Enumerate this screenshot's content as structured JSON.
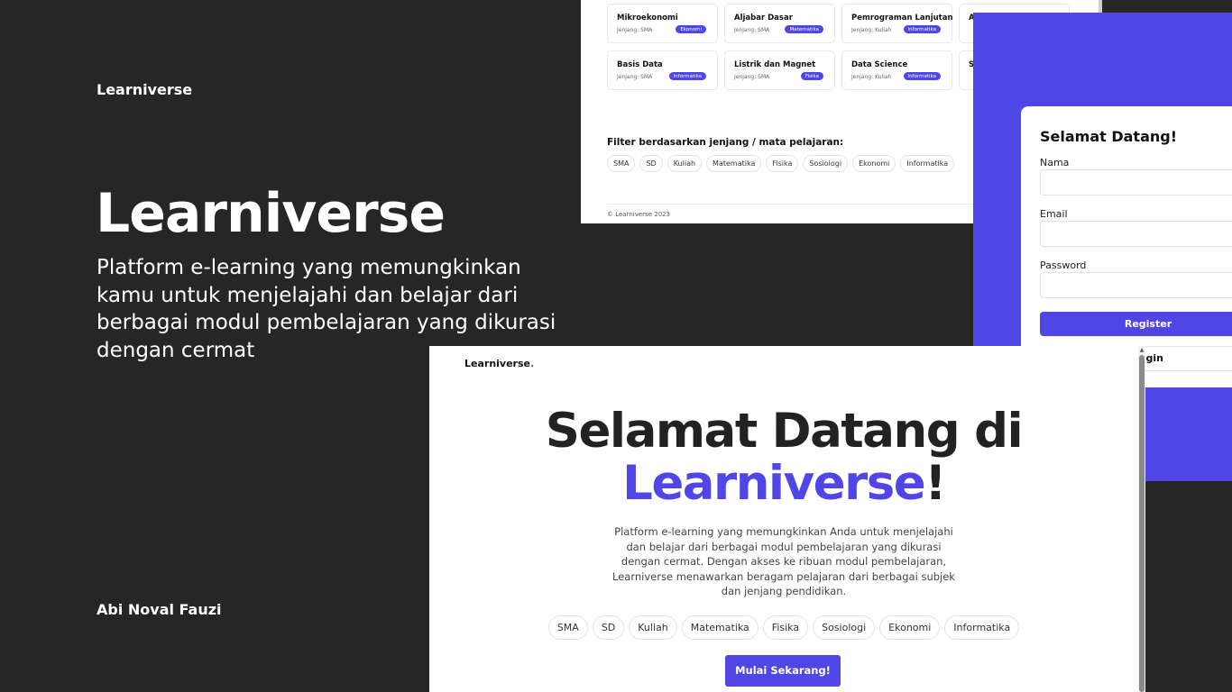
{
  "left": {
    "brand": "Learniverse",
    "title": "Learniverse",
    "description": "Platform e-learning yang memungkinkan kamu untuk menjelajahi dan belajar dari berbagai modul pembelajaran yang dikurasi dengan cermat",
    "author": "Abi Noval Fauzi"
  },
  "modules": {
    "cards": [
      {
        "title": "Mikroekonomi",
        "level": "Jenjang: SMA",
        "badge": "Ekonomi"
      },
      {
        "title": "Aljabar Dasar",
        "level": "Jenjang: SMA",
        "badge": "Matematika"
      },
      {
        "title": "Pemrograman Lanjutan",
        "level": "Jenjang: Kuliah",
        "badge": "Informatika"
      },
      {
        "title": "A",
        "level": "",
        "badge": ""
      },
      {
        "title": "Basis Data",
        "level": "Jenjang: SMA",
        "badge": "Informatika"
      },
      {
        "title": "Listrik dan Magnet",
        "level": "Jenjang: SMA",
        "badge": "Fisika"
      },
      {
        "title": "Data Science",
        "level": "Jenjang: Kuliah",
        "badge": "Informatika"
      },
      {
        "title": "S",
        "level": "",
        "badge": ""
      }
    ],
    "filter_title": "Filter berdasarkan jenjang / mata pelajaran:",
    "filters": [
      "SMA",
      "SD",
      "Kuliah",
      "Matematika",
      "Fisika",
      "Sosiologi",
      "Ekonomi",
      "Informatika"
    ],
    "footer": "© Learniverse 2023"
  },
  "register": {
    "title": "Selamat Datang!",
    "name_label": "Nama",
    "email_label": "Email",
    "password_label": "Password",
    "register_button": "Register",
    "login_button": "Login"
  },
  "landing": {
    "logo": "Learniverse",
    "logo_dot": ".",
    "heading_line1": "Selamat Datang di",
    "heading_accent": "Learniverse",
    "heading_end": "!",
    "description": "Platform e-learning yang memungkinkan Anda untuk menjelajahi dan belajar dari berbagai modul pembelajaran yang dikurasi dengan cermat. Dengan akses ke ribuan modul pembelajaran, Learniverse menawarkan beragam pelajaran dari berbagai subjek dan jenjang pendidikan.",
    "pills": [
      "SMA",
      "SD",
      "Kuliah",
      "Matematika",
      "Fisika",
      "Sosiologi",
      "Ekonomi",
      "Informatika"
    ],
    "cta": "Mulai Sekarang!"
  },
  "colors": {
    "background": "#262626",
    "accent": "#4f46e5"
  }
}
